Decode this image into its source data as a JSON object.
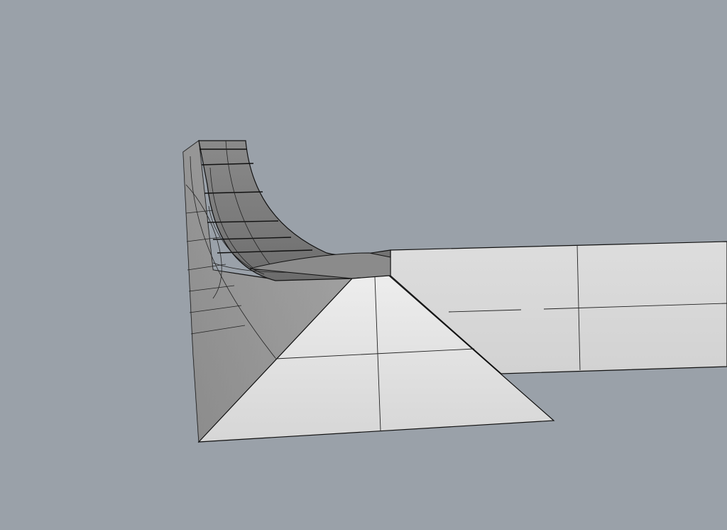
{
  "viewport": {
    "background": "#9aa1a9",
    "shading": "flat-gray",
    "edge_color": "#111111",
    "isocurve_color": "#222222"
  }
}
